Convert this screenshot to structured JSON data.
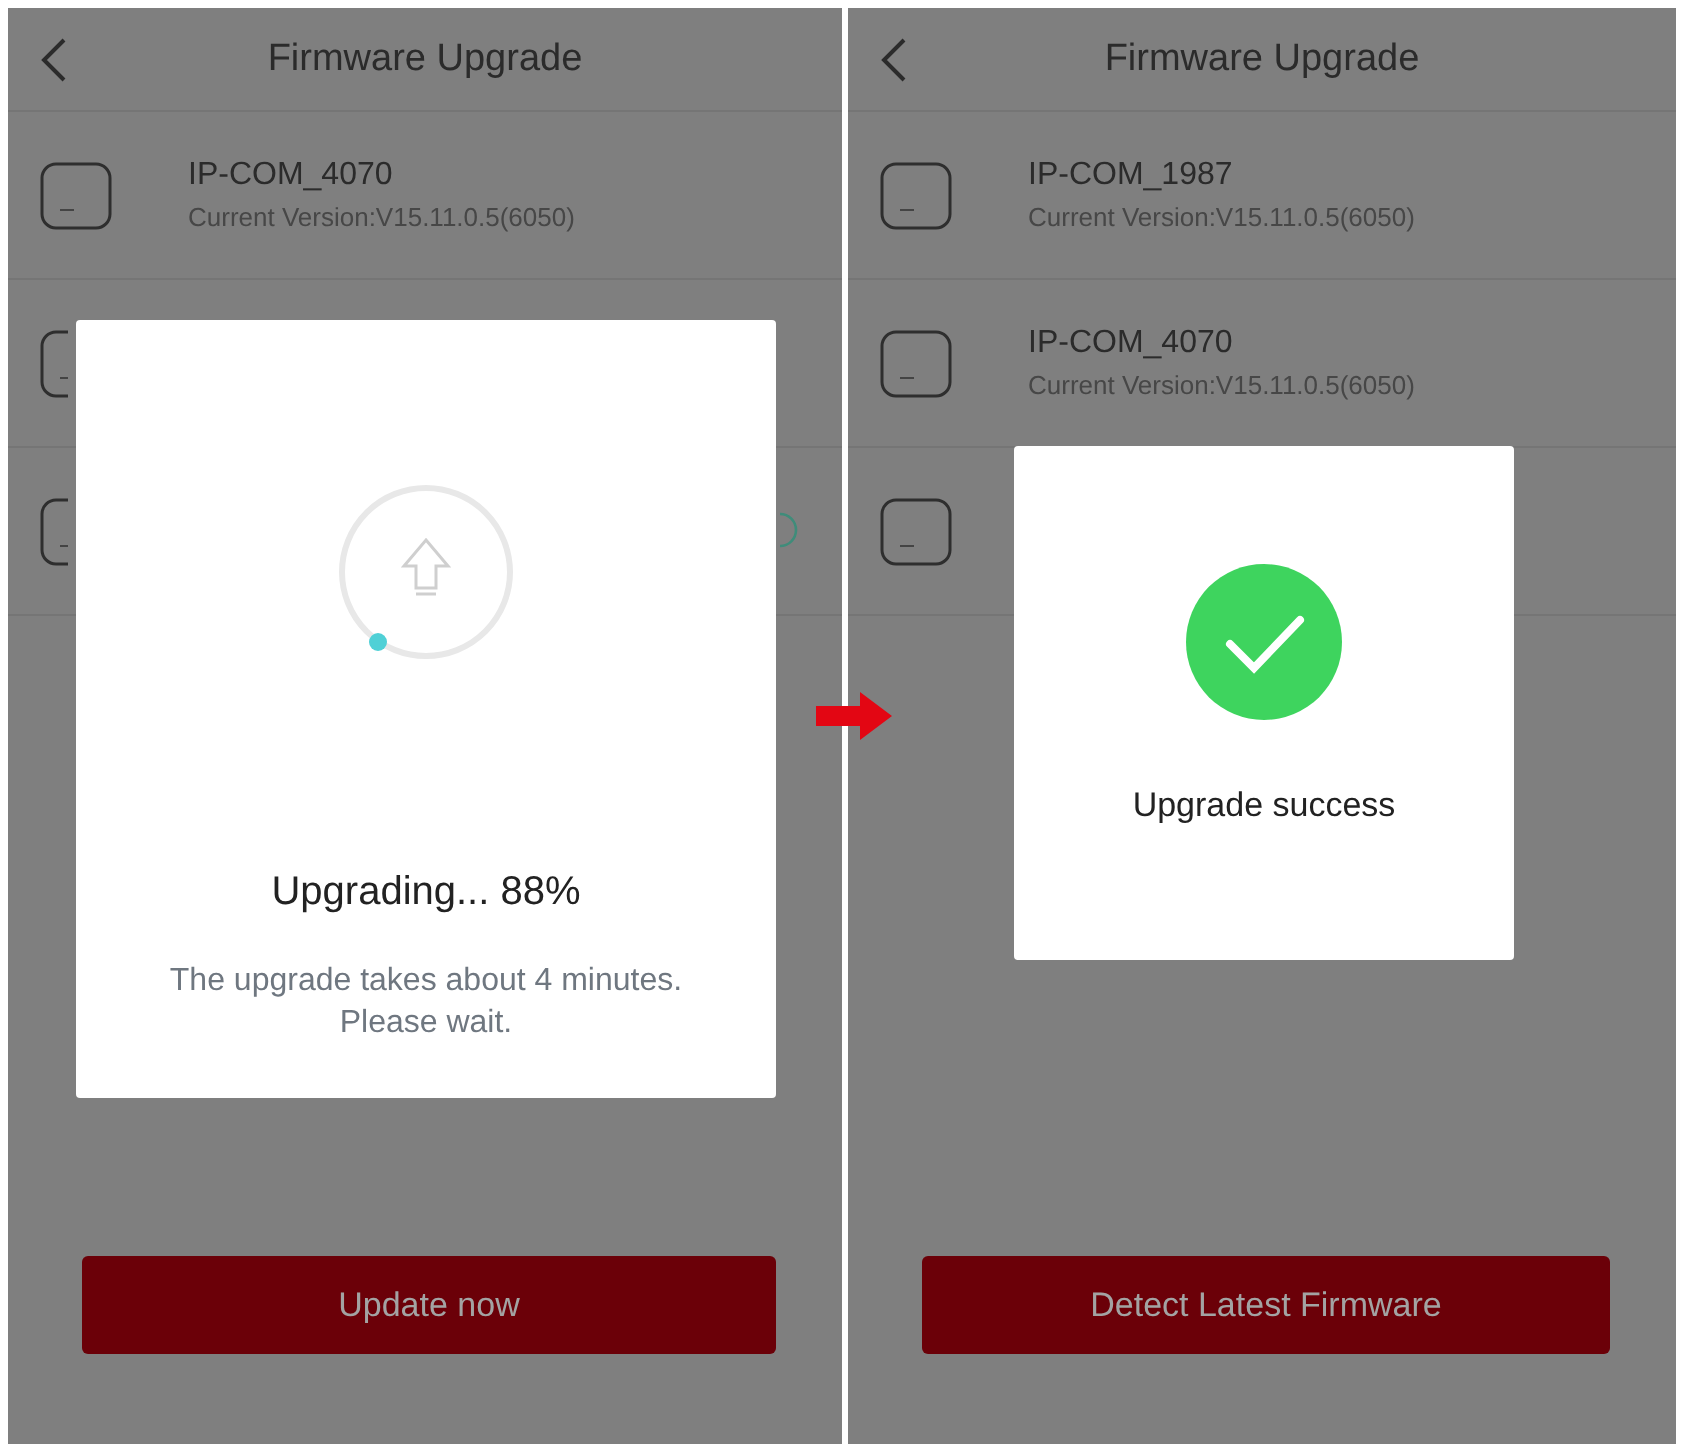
{
  "screens": [
    {
      "title": "Firmware Upgrade",
      "devices": [
        {
          "kind": "plain",
          "name": "IP-COM_4070",
          "version": "Current Version:V15.11.0.5(6050)"
        },
        {
          "kind": "plain"
        },
        {
          "kind": "status"
        }
      ],
      "dialog": {
        "kind": "progress",
        "title": "Upgrading... 88%",
        "message_lines": [
          "The upgrade takes about 4 minutes.",
          "Please wait."
        ]
      },
      "button": "Update now"
    },
    {
      "title": "Firmware Upgrade",
      "devices": [
        {
          "kind": "plain",
          "name": "IP-COM_1987",
          "version": "Current Version:V15.11.0.5(6050)"
        },
        {
          "kind": "plain",
          "name": "IP-COM_4070",
          "version": "Current Version:V15.11.0.5(6050)"
        },
        {
          "kind": "plain"
        }
      ],
      "dialog": {
        "kind": "success",
        "title": "Upgrade success"
      },
      "button": "Detect Latest Firmware"
    }
  ]
}
